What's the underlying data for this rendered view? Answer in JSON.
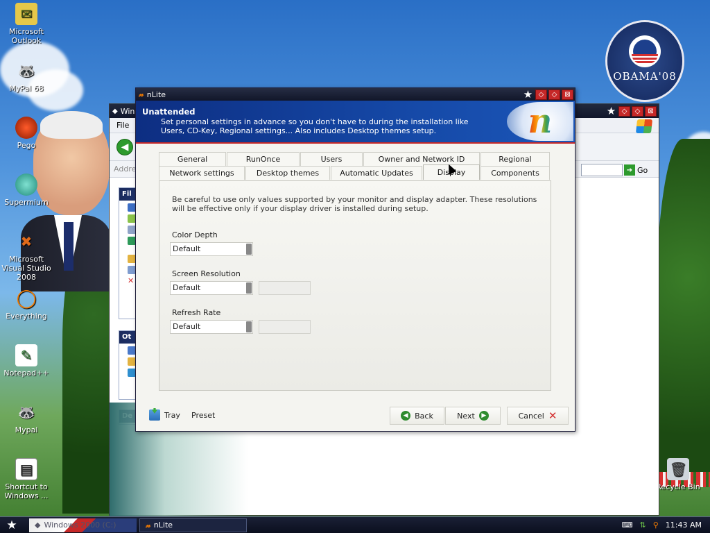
{
  "desktop": {
    "icons": [
      {
        "label": "Microsoft Outlook",
        "icon": "outlook-icon"
      },
      {
        "label": "MyPal 68",
        "icon": "mypal-icon"
      },
      {
        "label": "Pego",
        "icon": "pego-icon"
      },
      {
        "label": "Supermium",
        "icon": "supermium-icon"
      },
      {
        "label": "Microsoft Visual Studio 2008",
        "icon": "visual-studio-icon"
      },
      {
        "label": "Everything",
        "icon": "everything-icon"
      },
      {
        "label": "Notepad++",
        "icon": "notepadpp-icon"
      },
      {
        "label": "Mypal",
        "icon": "mypal-icon"
      },
      {
        "label": "Shortcut to Windows ...",
        "icon": "shortcut-icon"
      },
      {
        "label": "Recycle Bin",
        "icon": "recycle-bin-icon"
      }
    ],
    "obama_logo_text": "OBAMA'08"
  },
  "background_window": {
    "title": "Win",
    "menu_file": "File",
    "address_label": "Addres",
    "go_label": "Go",
    "panels": [
      "Fil",
      "Ot",
      "De"
    ]
  },
  "dialog": {
    "title": "nLite",
    "header_title": "Unattended",
    "header_desc": "Set personal settings in advance so you don't have to during the installation like Users, CD-Key, Regional settings... Also includes Desktop themes setup.",
    "tabs_row1": [
      "General",
      "RunOnce",
      "Users",
      "Owner and Network ID",
      "Regional"
    ],
    "tabs_row2": [
      "Network settings",
      "Desktop themes",
      "Automatic Updates",
      "Display",
      "Components"
    ],
    "active_tab": "Display",
    "note": "Be careful to use only values supported by your monitor and display adapter. These resolutions will be effective only if your display driver is installed during setup.",
    "fields": [
      {
        "label": "Color Depth",
        "value": "Default"
      },
      {
        "label": "Screen Resolution",
        "value": "Default"
      },
      {
        "label": "Refresh Rate",
        "value": "Default"
      }
    ],
    "buttons": {
      "tray": "Tray",
      "preset": "Preset",
      "back": "Back",
      "next": "Next",
      "cancel": "Cancel"
    }
  },
  "taskbar": {
    "task1": "Windows 2000 (C:)",
    "task2": "nLite",
    "clock": "11:43 AM"
  }
}
